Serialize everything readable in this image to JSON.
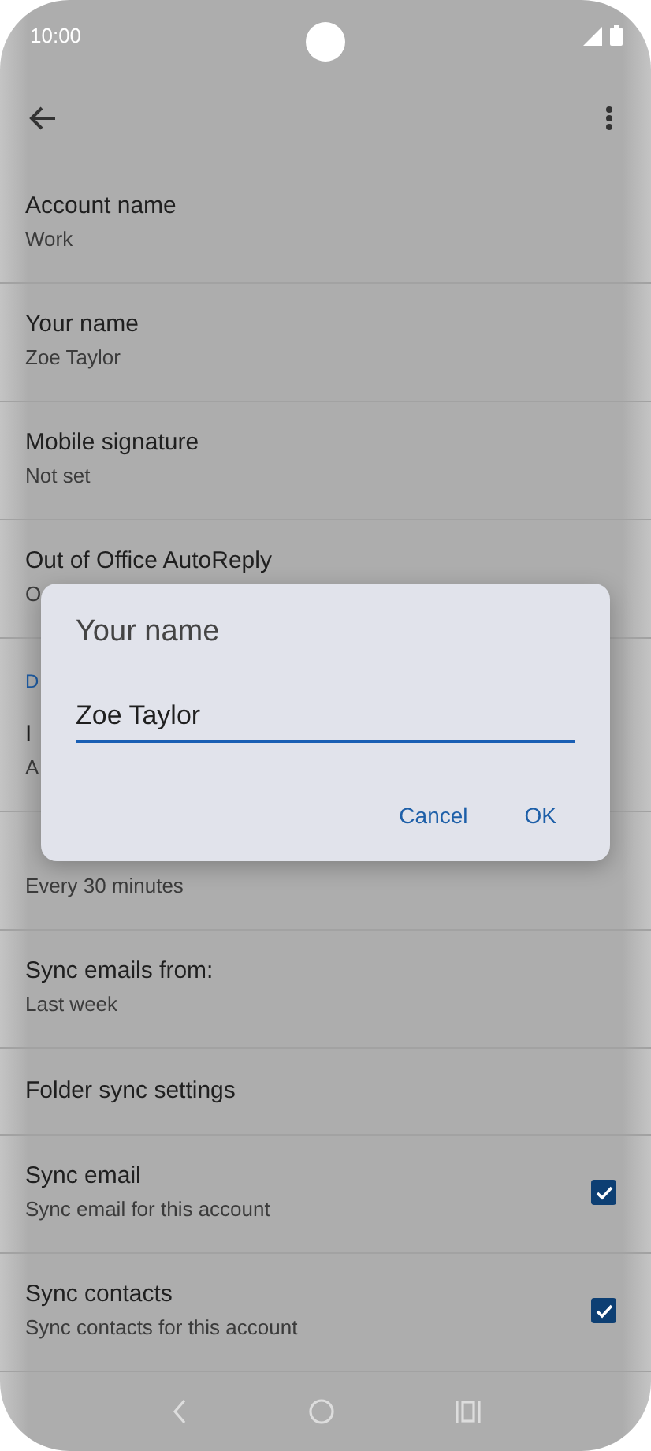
{
  "status_bar": {
    "time": "10:00"
  },
  "settings": [
    {
      "kind": "item",
      "title": "Account name",
      "subtitle": "Work"
    },
    {
      "kind": "item",
      "title": "Your name",
      "subtitle": "Zoe Taylor"
    },
    {
      "kind": "item",
      "title": "Mobile signature",
      "subtitle": "Not set"
    },
    {
      "kind": "item",
      "title": "Out of Office AutoReply",
      "subtitle": "O"
    },
    {
      "kind": "header",
      "title": "D"
    },
    {
      "kind": "item",
      "title": "I",
      "subtitle": "A"
    },
    {
      "kind": "item",
      "subtitle": "Every 30 minutes"
    },
    {
      "kind": "item",
      "title": "Sync emails from:",
      "subtitle": "Last week"
    },
    {
      "kind": "item",
      "title": "Folder sync settings"
    },
    {
      "kind": "checkbox",
      "title": "Sync email",
      "subtitle": "Sync email for this account",
      "checked": true
    },
    {
      "kind": "checkbox",
      "title": "Sync contacts",
      "subtitle": "Sync contacts for this account",
      "checked": true
    }
  ],
  "dialog": {
    "title": "Your name",
    "value": "Zoe Taylor",
    "buttons": [
      "Cancel",
      "OK"
    ]
  }
}
